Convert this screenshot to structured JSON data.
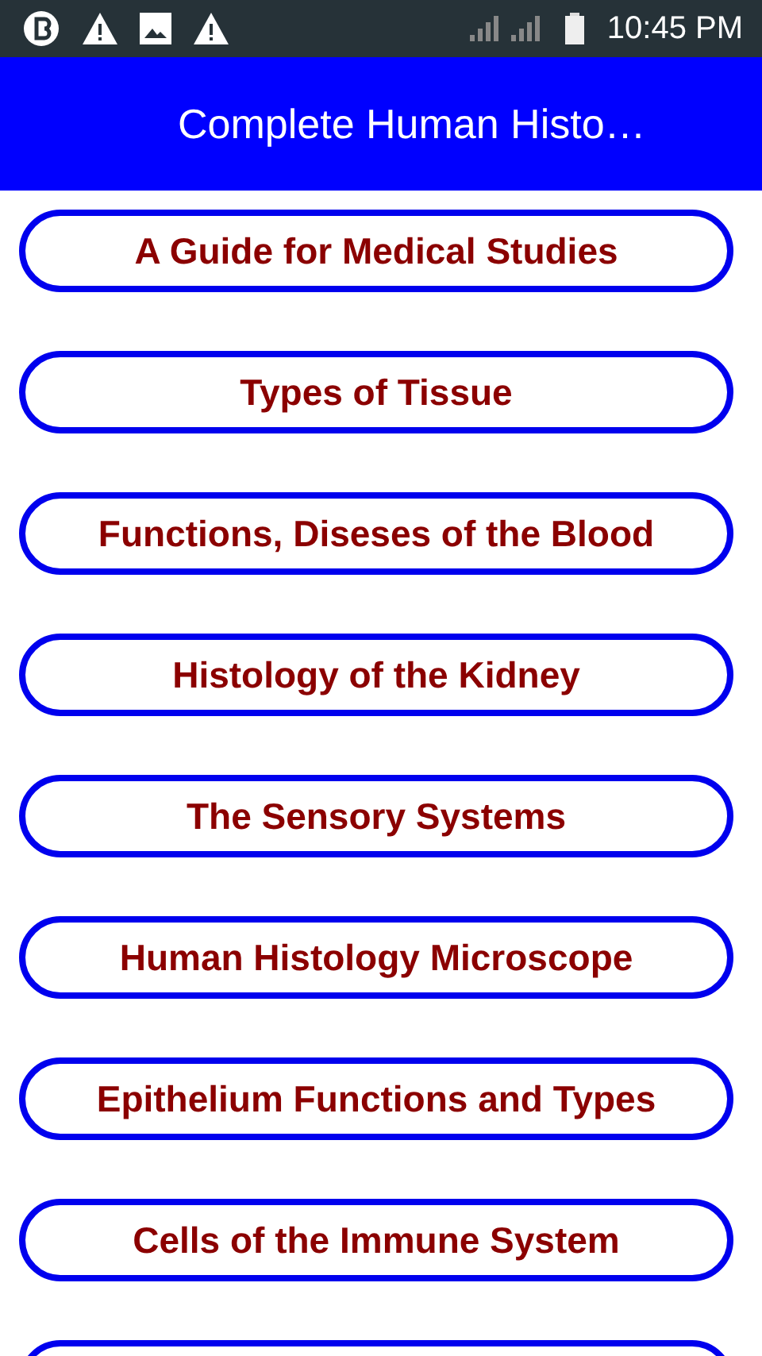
{
  "status_bar": {
    "time": "10:45 PM"
  },
  "app_bar": {
    "title": "Complete Human Histo…"
  },
  "buttons": [
    {
      "label": "A Guide for Medical Studies"
    },
    {
      "label": "Types of Tissue"
    },
    {
      "label": "Functions, Diseses of the Blood"
    },
    {
      "label": "Histology of the Kidney"
    },
    {
      "label": "The Sensory Systems"
    },
    {
      "label": "Human Histology Microscope"
    },
    {
      "label": "Epithelium Functions and Types"
    },
    {
      "label": "Cells of the Immune System"
    }
  ],
  "more_below": true
}
